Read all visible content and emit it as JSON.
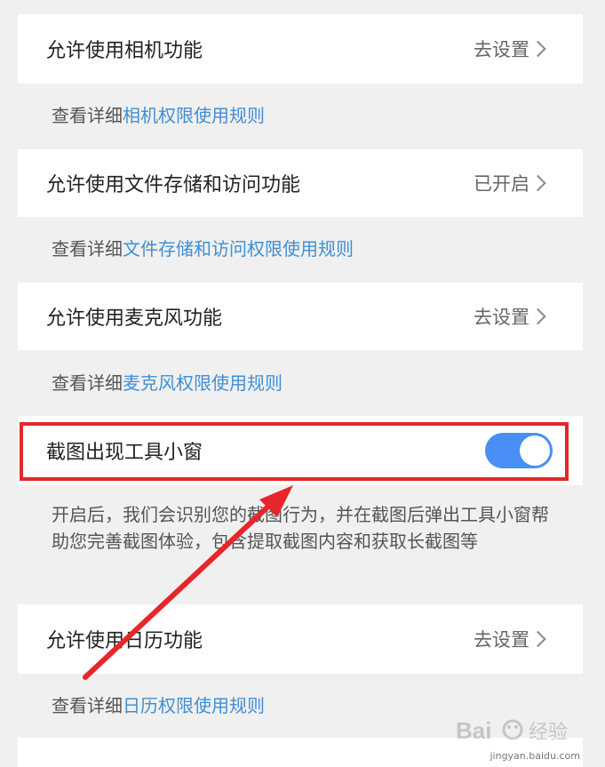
{
  "rows": {
    "camera": {
      "title": "允许使用相机功能",
      "status": "去设置"
    },
    "camera_note": {
      "prefix": "查看详细",
      "link": "相机权限使用规则"
    },
    "storage": {
      "title": "允许使用文件存储和访问功能",
      "status": "已开启"
    },
    "storage_note": {
      "prefix": "查看详细",
      "link": "文件存储和访问权限使用规则"
    },
    "mic": {
      "title": "允许使用麦克风功能",
      "status": "去设置"
    },
    "mic_note": {
      "prefix": "查看详细",
      "link": "麦克风权限使用规则"
    },
    "screenshot": {
      "title": "截图出现工具小窗",
      "toggle_on": true
    },
    "screenshot_desc": "开启后，我们会识别您的截图行为，并在截图后弹出工具小窗帮助您完善截图体验，包含提取截图内容和获取长截图等",
    "calendar": {
      "title": "允许使用日历功能",
      "status": "去设置"
    },
    "calendar_note": {
      "prefix": "查看详细",
      "link": "日历权限使用规则"
    }
  },
  "watermark": {
    "text": "Bai",
    "text2": "经验",
    "sub": "jingyan.baidu.com"
  },
  "colors": {
    "background": "#f0f0f0",
    "card": "#ffffff",
    "link": "#3f8fd6",
    "toggle_on": "#4a8ff5",
    "annotation": "#e6262b"
  }
}
